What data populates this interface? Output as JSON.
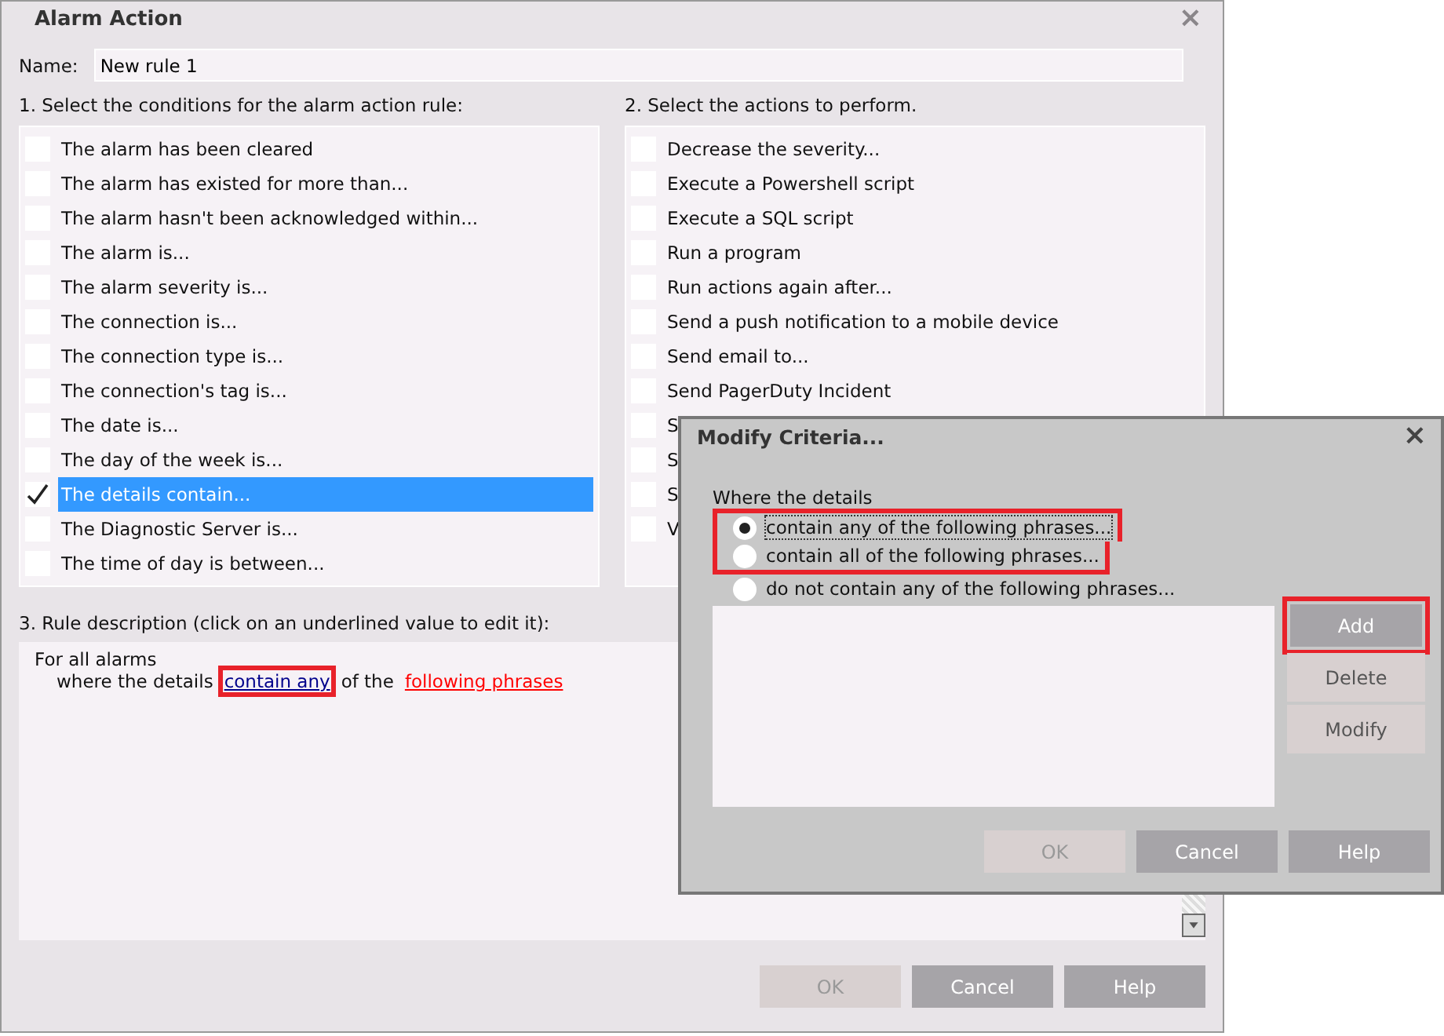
{
  "window": {
    "title": "Alarm Action",
    "close": "×"
  },
  "name_field": {
    "label": "Name:",
    "value": "New rule 1"
  },
  "conditions": {
    "label": "1. Select the conditions for the alarm action rule:",
    "items": [
      {
        "label": "The alarm has been cleared",
        "checked": false,
        "selected": false
      },
      {
        "label": "The alarm has existed for more than...",
        "checked": false,
        "selected": false
      },
      {
        "label": "The alarm hasn't been acknowledged within...",
        "checked": false,
        "selected": false
      },
      {
        "label": "The alarm is...",
        "checked": false,
        "selected": false
      },
      {
        "label": "The alarm severity is...",
        "checked": false,
        "selected": false
      },
      {
        "label": "The connection is...",
        "checked": false,
        "selected": false
      },
      {
        "label": "The connection type is...",
        "checked": false,
        "selected": false
      },
      {
        "label": "The connection's tag is...",
        "checked": false,
        "selected": false
      },
      {
        "label": "The date is...",
        "checked": false,
        "selected": false
      },
      {
        "label": "The day of the week is...",
        "checked": false,
        "selected": false
      },
      {
        "label": "The details contain...",
        "checked": true,
        "selected": true
      },
      {
        "label": "The Diagnostic Server is...",
        "checked": false,
        "selected": false
      },
      {
        "label": "The time of day is between...",
        "checked": false,
        "selected": false
      }
    ]
  },
  "actions": {
    "label": "2. Select the actions to perform.",
    "items": [
      {
        "label": "Decrease the severity...",
        "checked": false
      },
      {
        "label": "Execute a Powershell script",
        "checked": false
      },
      {
        "label": "Execute a SQL script",
        "checked": false
      },
      {
        "label": "Run a program",
        "checked": false
      },
      {
        "label": "Run actions again after...",
        "checked": false
      },
      {
        "label": "Send a push notification to a mobile device",
        "checked": false
      },
      {
        "label": "Send email to...",
        "checked": false
      },
      {
        "label": "Send PagerDuty Incident",
        "checked": false
      },
      {
        "label": "S",
        "checked": false
      },
      {
        "label": "S",
        "checked": false
      },
      {
        "label": "S",
        "checked": false
      },
      {
        "label": "V",
        "checked": false
      }
    ]
  },
  "rule_description": {
    "label": "3. Rule description (click on an underlined value to edit it):",
    "line_1": "For all alarms",
    "parts": [
      {
        "kind": "text",
        "text": "where the details"
      },
      {
        "kind": "link",
        "text": "contain any",
        "color": "#00008b",
        "highlighted": true
      },
      {
        "kind": "text",
        "text": "of the"
      },
      {
        "kind": "link",
        "text": "following phrases",
        "color": "#ff0000",
        "highlighted": false
      }
    ]
  },
  "buttons": [
    {
      "label": "OK",
      "disabled": true
    },
    {
      "label": "Cancel",
      "disabled": false
    },
    {
      "label": "Help",
      "disabled": false
    }
  ],
  "modify_dialog": {
    "title": "Modify Criteria...",
    "close": "×",
    "prompt": "Where the details",
    "options": [
      {
        "label": "contain any of the following phrases...",
        "selected": true,
        "highlighted": true
      },
      {
        "label": "contain all of the following phrases...",
        "selected": false,
        "highlighted": true
      },
      {
        "label": "do not contain any of the following phrases...",
        "selected": false,
        "highlighted": false
      }
    ],
    "side_buttons": [
      {
        "label": "Add",
        "disabled": false,
        "highlighted": true
      },
      {
        "label": "Delete",
        "disabled": true,
        "highlighted": false
      },
      {
        "label": "Modify",
        "disabled": true,
        "highlighted": false
      }
    ],
    "buttons": [
      {
        "label": "OK",
        "disabled": true
      },
      {
        "label": "Cancel",
        "disabled": false
      },
      {
        "label": "Help",
        "disabled": false
      }
    ]
  }
}
